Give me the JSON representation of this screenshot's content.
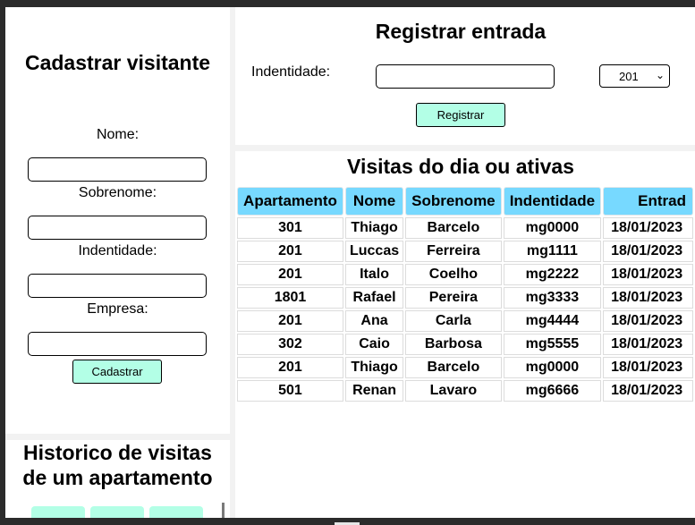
{
  "cadastro": {
    "title": "Cadastrar visitante",
    "fields": [
      {
        "label": "Nome:",
        "value": ""
      },
      {
        "label": "Sobrenome:",
        "value": ""
      },
      {
        "label": "Indentidade:",
        "value": ""
      },
      {
        "label": "Empresa:",
        "value": ""
      }
    ],
    "submit_label": "Cadastrar"
  },
  "historico": {
    "title_line1": "Historico de visitas",
    "title_line2": "de um apartamento"
  },
  "registro": {
    "title": "Registrar entrada",
    "identity_label": "Indentidade:",
    "identity_value": "",
    "apartment_selected": "201",
    "submit_label": "Registrar"
  },
  "visitas": {
    "title": "Visitas do dia ou ativas",
    "columns": [
      "Apartamento",
      "Nome",
      "Sobrenome",
      "Indentidade",
      "Entrad"
    ],
    "rows": [
      [
        "301",
        "Thiago",
        "Barcelo",
        "mg0000",
        "18/01/2023"
      ],
      [
        "201",
        "Luccas",
        "Ferreira",
        "mg1111",
        "18/01/2023"
      ],
      [
        "201",
        "Italo",
        "Coelho",
        "mg2222",
        "18/01/2023"
      ],
      [
        "1801",
        "Rafael",
        "Pereira",
        "mg3333",
        "18/01/2023"
      ],
      [
        "201",
        "Ana",
        "Carla",
        "mg4444",
        "18/01/2023"
      ],
      [
        "302",
        "Caio",
        "Barbosa",
        "mg5555",
        "18/01/2023"
      ],
      [
        "201",
        "Thiago",
        "Barcelo",
        "mg0000",
        "18/01/2023"
      ],
      [
        "501",
        "Renan",
        "Lavaro",
        "mg6666",
        "18/01/2023"
      ]
    ]
  },
  "colors": {
    "button": "#b3ffe6",
    "table_header": "#77d9ff",
    "background": "#f2f2f2",
    "window_chrome": "#2b2b2b"
  }
}
